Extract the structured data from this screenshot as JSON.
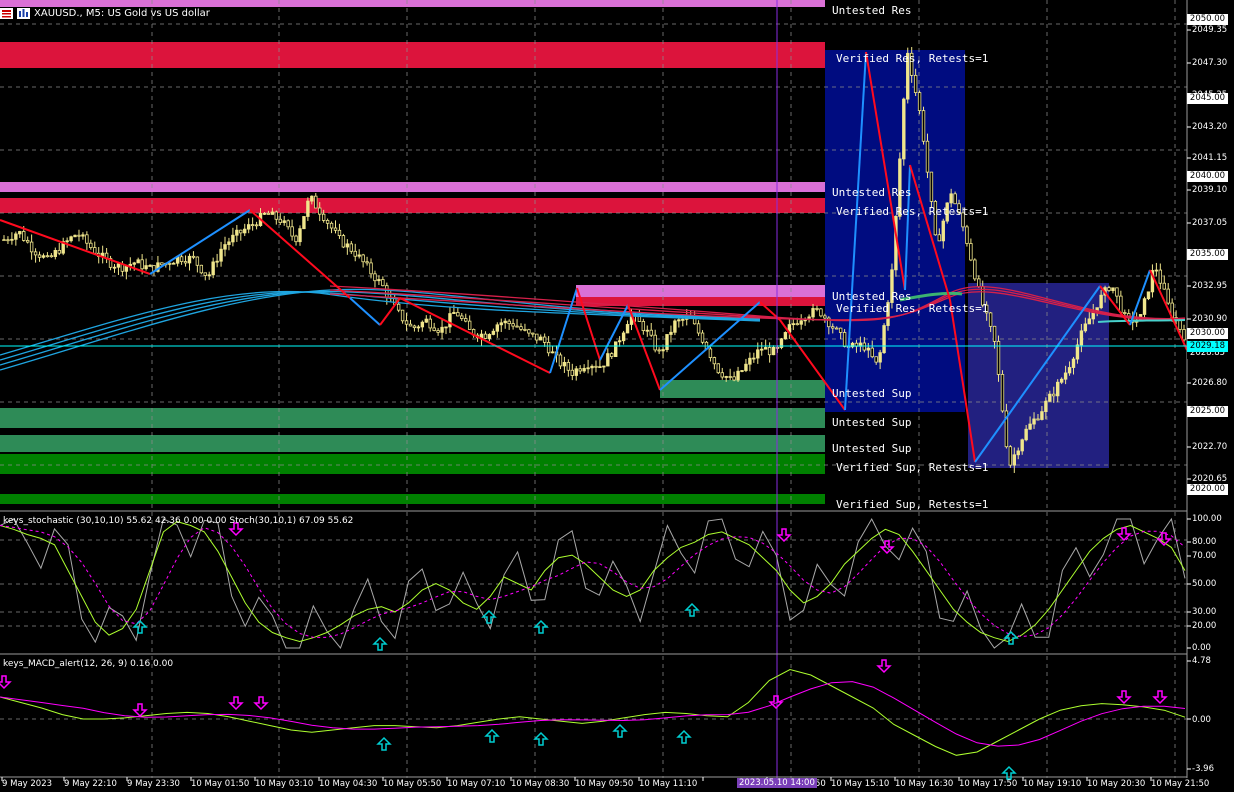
{
  "header": {
    "symbol_title": "XAUUSD., M5:  US Gold vs US dollar"
  },
  "indicators": {
    "stoch_label": "keys_stochastic (30,10,10) 55.62 42.36 0.00 0.00 Stoch(30,10,1) 67.09 55.62",
    "macd_label": "keys_MACD_alert(12, 26, 9) 0.16 0.00"
  },
  "price_axis": [
    "2049.35",
    "2047.30",
    "2045.25",
    "2043.20",
    "2041.15",
    "2039.10",
    "2037.05",
    "2032.95",
    "2030.90",
    "2028.85",
    "2026.80",
    "2022.70",
    "2020.65"
  ],
  "price_tags": {
    "p2050": "2050.00",
    "p2045": "2045.00",
    "p2040": "2040.00",
    "p2035": "2035.00",
    "p2030": "2030.00",
    "p2025": "2025.00",
    "p2020": "2020.00",
    "current": "2029.18"
  },
  "stoch_axis": [
    "100.00",
    "80.00",
    "70.00",
    "50.00",
    "30.00",
    "20.00",
    "0.00"
  ],
  "macd_axis": [
    "4.78",
    "0.00",
    "-3.96"
  ],
  "time_axis": [
    "9 May 2023",
    "9 May 22:10",
    "9 May 23:30",
    "10 May 01:50",
    "10 May 03:10",
    "10 May 04:30",
    "10 May 05:50",
    "10 May 07:10",
    "10 May 08:30",
    "10 May 09:50",
    "10 May 11:10",
    "10 May 15:10",
    "10 May 16:30",
    "10 May 17:50",
    "10 May 19:10",
    "10 May 20:30",
    "10 May 21:50"
  ],
  "time_cursor": "2023.05.10 14:00",
  "time_cursor_tail": "50",
  "zones": [
    "Untested Res",
    "Verified Res, Retests=1",
    "Untested Res",
    "Verified Res, Retests=1",
    "Untested Res",
    "Verified Res, Retests=1",
    "Untested Sup",
    "Untested Sup",
    "Untested Sup",
    "Verified Sup, Retests=1",
    "Verified Sup, Retests=1"
  ],
  "colors": {
    "resistance": "#dc143c",
    "res_thin": "#da70d6",
    "support": "#2e8b57",
    "support_dark": "#008000",
    "zigzag_red": "#ff0a1e",
    "zigzag_blue": "#1e90ff",
    "ma_blue": "#1fa5e0",
    "ma_red": "#d6204a",
    "candle": "#f0e68c",
    "stoch_main": "#adff2f",
    "stoch_signal": "#ff00ff",
    "arrow_up": "#00ced1",
    "arrow_down": "#ff00ff",
    "box_blue": "#000c80",
    "box_slate": "#222080",
    "cursor": "#8a2be2",
    "current_line": "#00ffff"
  },
  "chart_data": {
    "type": "candlestick",
    "main": {
      "price_range": [
        2019.3,
        2050.8
      ],
      "close_series": [
        2036.0,
        2036.5,
        2035.4,
        2034.7,
        2035.6,
        2036.4,
        2035.5,
        2034.7,
        2034.3,
        2034.6,
        2034.2,
        2034.5,
        2034.9,
        2034.8,
        2033.7,
        2035.6,
        2036.3,
        2036.9,
        2037.6,
        2037.2,
        2036.0,
        2038.6,
        2037.4,
        2036.0,
        2035.3,
        2034.2,
        2033.1,
        2031.5,
        2030.5,
        2031.0,
        2030.4,
        2031.6,
        2030.3,
        2030.1,
        2030.9,
        2030.8,
        2030.1,
        2029.8,
        2028.5,
        2027.8,
        2028.4,
        2028.2,
        2029.4,
        2031.4,
        2030.5,
        2028.9,
        2030.8,
        2031.2,
        2029.8,
        2028.0,
        2027.2,
        2028.3,
        2029.3,
        2029.0,
        2030.7,
        2031.4,
        2031.6,
        2030.5,
        2029.3,
        2029.5,
        2028.1,
        2034.3,
        2047.8,
        2043.2,
        2035.5,
        2039.0,
        2036.3,
        2032.5,
        2029.6,
        2022.0,
        2024.0,
        2025.2,
        2026.5,
        2028.0,
        2030.2,
        2032.0,
        2033.3,
        2031.0,
        2031.1,
        2034.5,
        2031.7,
        2030.1
      ],
      "zigzag_points": [
        [
          2036.2,
          "start"
        ],
        [
          2034.2,
          "low"
        ],
        [
          2038.6,
          "high"
        ],
        [
          2033.4,
          "low"
        ],
        [
          2030.3,
          "low2"
        ],
        [
          2032.9,
          "high2"
        ],
        [
          2027.8,
          "low3"
        ],
        [
          2032.8,
          "high3"
        ],
        [
          2029.5,
          "low4"
        ],
        [
          2031.6,
          "high4"
        ],
        [
          2026.5,
          "low5"
        ],
        [
          2047.8,
          "peak"
        ],
        [
          2035.5,
          "drop"
        ],
        [
          2040.2,
          "bounce"
        ],
        [
          2022.0,
          "bottom"
        ],
        [
          2033.3,
          "recover"
        ],
        [
          2034.5,
          "high5"
        ],
        [
          2029.2,
          "end"
        ]
      ],
      "current_price": 2029.18
    },
    "stochastic": {
      "range": [
        0,
        100
      ],
      "main_last": 55.62,
      "signal_last": 42.36,
      "levels": [
        20,
        30,
        50,
        70,
        80
      ]
    },
    "macd": {
      "range": [
        -3.96,
        4.78
      ],
      "main_last": 0.16,
      "signal_last": 0.0
    }
  }
}
